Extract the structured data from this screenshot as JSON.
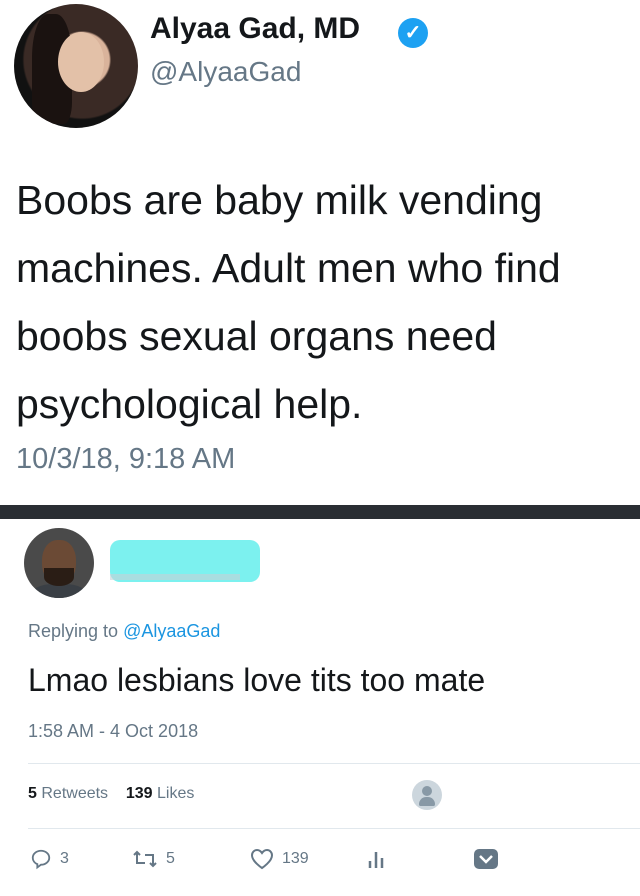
{
  "tweet": {
    "author_name": "Alyaa Gad, MD",
    "verified_glyph": "✓",
    "handle": "@AlyaaGad",
    "text": "Boobs are baby milk vending machines. Adult men who find boobs sexual organs need psychological help.",
    "timestamp": "10/3/18, 9:18 AM"
  },
  "reply": {
    "replying_prefix": "Replying to",
    "replying_handle": "@AlyaaGad",
    "text": "Lmao lesbians love tits too mate",
    "timestamp": "1:58 AM - 4 Oct 2018",
    "retweets_count": "5",
    "retweets_label": "Retweets",
    "likes_count": "139",
    "likes_label": "Likes",
    "actions": {
      "reply_count": "3",
      "retweet_count": "5",
      "like_count": "139"
    }
  },
  "colors": {
    "accent": "#1da1f2",
    "redaction": "#7cf1ef",
    "divider": "#2a2e33",
    "muted": "#657786"
  },
  "icons": [
    "verified-badge-icon",
    "reply-icon",
    "retweet-icon",
    "like-icon",
    "analytics-icon",
    "dropdown-icon",
    "default-avatar-icon"
  ]
}
